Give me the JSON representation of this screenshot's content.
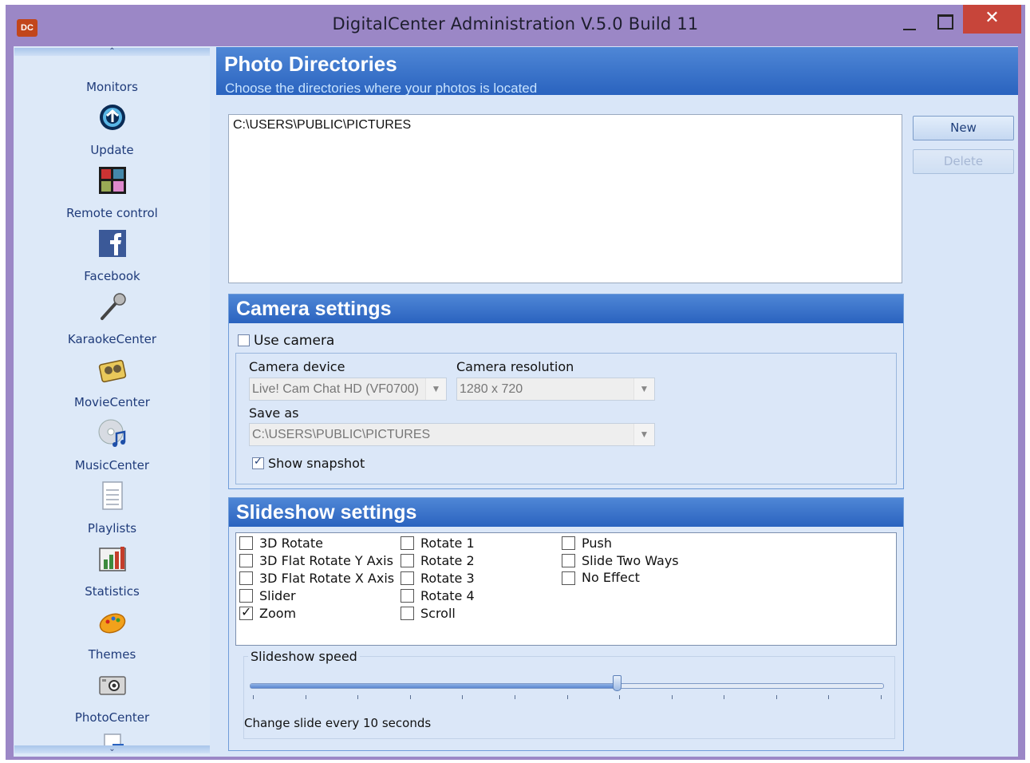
{
  "window": {
    "title": "DigitalCenter Administration V.5.0 Build 11",
    "app_icon_text": "DC",
    "close_glyph": "✕"
  },
  "sidebar": {
    "scroll_up_glyph": "⌃",
    "scroll_down_glyph": "⌄",
    "items": [
      {
        "label": "Monitors",
        "icon": "monitor-icon"
      },
      {
        "label": "Update",
        "icon": "update-icon"
      },
      {
        "label": "Remote control",
        "icon": "remote-control-icon"
      },
      {
        "label": "Facebook",
        "icon": "facebook-icon"
      },
      {
        "label": "KaraokeCenter",
        "icon": "microphone-icon"
      },
      {
        "label": "MovieCenter",
        "icon": "film-reel-icon"
      },
      {
        "label": "MusicCenter",
        "icon": "music-disc-icon"
      },
      {
        "label": "Playlists",
        "icon": "playlist-icon"
      },
      {
        "label": "Statistics",
        "icon": "bar-chart-icon"
      },
      {
        "label": "Themes",
        "icon": "palette-icon"
      },
      {
        "label": "PhotoCenter",
        "icon": "camera-icon"
      }
    ]
  },
  "header": {
    "title": "Photo Directories",
    "subtitle": "Choose the directories where your photos is located"
  },
  "directories": [
    "C:\\USERS\\PUBLIC\\PICTURES"
  ],
  "buttons": {
    "new": "New",
    "delete": "Delete",
    "delete_enabled": false
  },
  "camera": {
    "title": "Camera settings",
    "use_camera_label": "Use camera",
    "use_camera": false,
    "device_label": "Camera device",
    "device_value": "Live! Cam Chat HD (VF0700)",
    "resolution_label": "Camera resolution",
    "resolution_value": "1280 x 720",
    "save_as_label": "Save as",
    "save_as_value": "C:\\USERS\\PUBLIC\\PICTURES",
    "show_snapshot_label": "Show snapshot",
    "show_snapshot": true
  },
  "slideshow": {
    "title": "Slideshow settings",
    "effects": [
      {
        "label": "3D Rotate",
        "checked": false
      },
      {
        "label": "3D Flat Rotate Y Axis",
        "checked": false
      },
      {
        "label": "3D Flat Rotate X Axis",
        "checked": false
      },
      {
        "label": "Slider",
        "checked": false
      },
      {
        "label": "Zoom",
        "checked": true
      },
      {
        "label": "Rotate 1",
        "checked": false
      },
      {
        "label": "Rotate 2",
        "checked": false
      },
      {
        "label": "Rotate 3",
        "checked": false
      },
      {
        "label": "Rotate 4",
        "checked": false
      },
      {
        "label": "Scroll",
        "checked": false
      },
      {
        "label": "Push",
        "checked": false
      },
      {
        "label": "Slide Two Ways",
        "checked": false
      },
      {
        "label": "No Effect",
        "checked": false
      }
    ],
    "speed_label": "Slideshow speed",
    "speed_fraction": 0.58,
    "speed_text": "Change slide every 10 seconds",
    "accent_color": "#2a63bf"
  }
}
